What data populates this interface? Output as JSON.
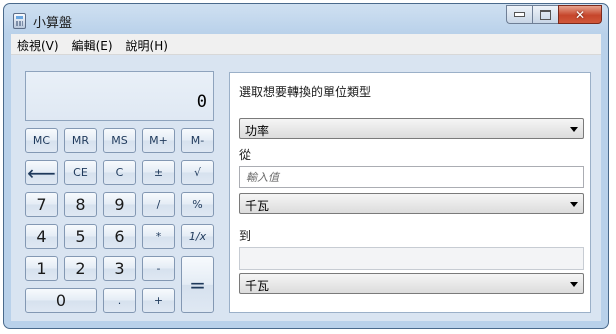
{
  "window": {
    "title": "小算盤"
  },
  "menu": {
    "items": [
      "檢視(V)",
      "編輯(E)",
      "說明(H)"
    ]
  },
  "calculator": {
    "display": "0",
    "keys": {
      "mc": "MC",
      "mr": "MR",
      "ms": "MS",
      "mplus": "M+",
      "mminus": "M-",
      "backspace": "⟵",
      "ce": "CE",
      "c": "C",
      "plusminus": "±",
      "sqrt": "√",
      "d7": "7",
      "d8": "8",
      "d9": "9",
      "div": "/",
      "percent": "%",
      "d4": "4",
      "d5": "5",
      "d6": "6",
      "mul": "*",
      "recip": "1/x",
      "d1": "1",
      "d2": "2",
      "d3": "3",
      "minus": "-",
      "equals": "=",
      "d0": "0",
      "dot": ".",
      "plus": "+"
    }
  },
  "converter": {
    "heading": "選取想要轉換的單位類型",
    "unit_type": "功率",
    "from_label": "從",
    "input_placeholder": "輸入值",
    "from_unit": "千瓦",
    "to_label": "到",
    "result_value": "",
    "to_unit": "千瓦"
  }
}
